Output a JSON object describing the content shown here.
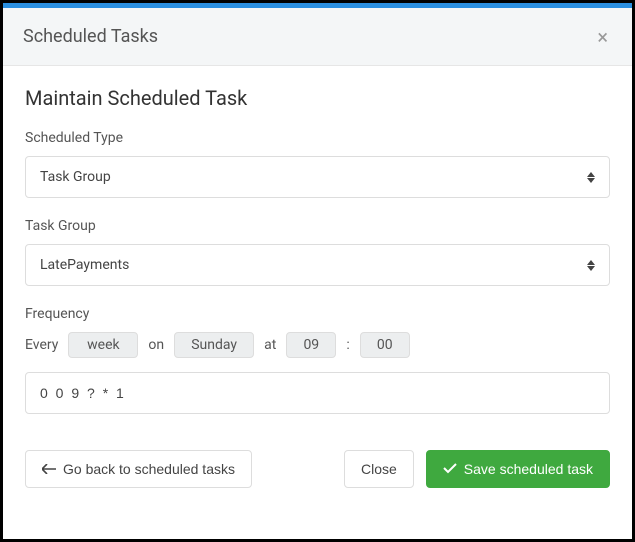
{
  "header": {
    "title": "Scheduled Tasks"
  },
  "section": {
    "title": "Maintain Scheduled Task"
  },
  "fields": {
    "scheduled_type": {
      "label": "Scheduled Type",
      "value": "Task Group"
    },
    "task_group": {
      "label": "Task Group",
      "value": "LatePayments"
    },
    "frequency": {
      "label": "Frequency",
      "every_text": "Every",
      "interval": "week",
      "on_text": "on",
      "day": "Sunday",
      "at_text": "at",
      "hour": "09",
      "colon": ":",
      "minute": "00",
      "cron": "0 0 9 ? * 1"
    }
  },
  "buttons": {
    "back": "Go back to scheduled tasks",
    "close": "Close",
    "save": "Save scheduled task"
  }
}
